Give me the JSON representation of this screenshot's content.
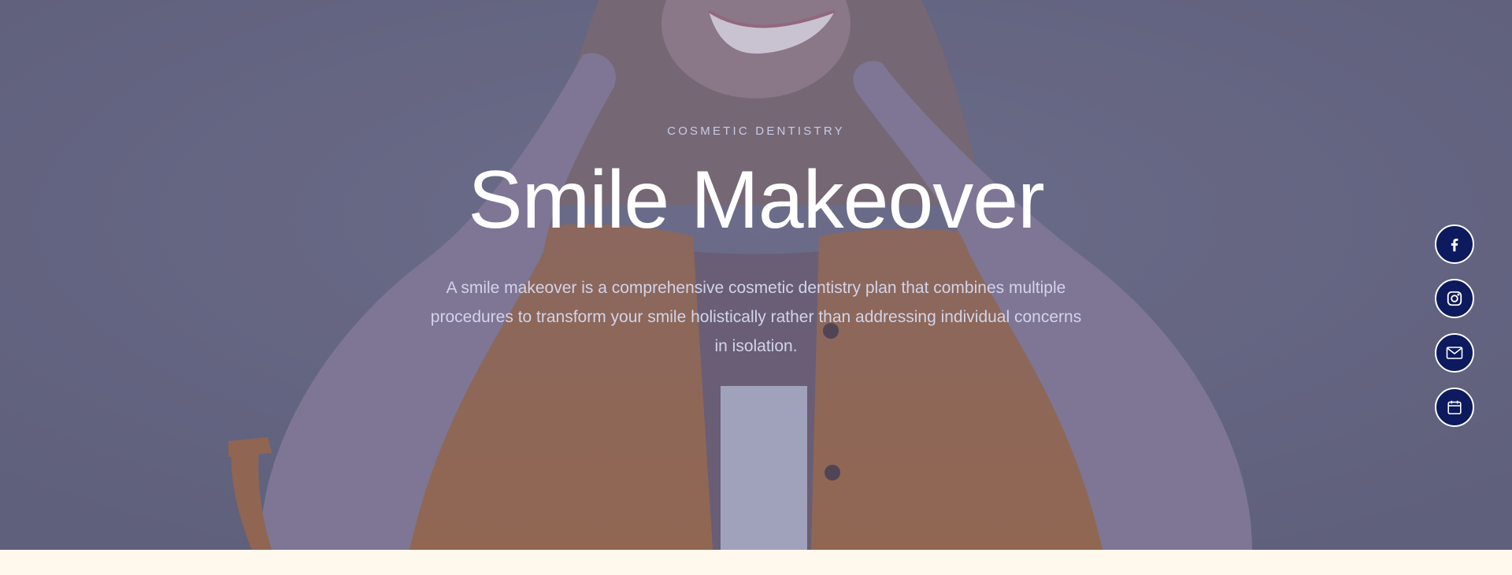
{
  "hero": {
    "eyebrow": "COSMETIC DENTISTRY",
    "title": "Smile Makeover",
    "description": "A smile makeover is a comprehensive cosmetic dentistry plan that combines multiple procedures to transform your smile holistically rather than addressing individual concerns in isolation."
  },
  "social": [
    {
      "icon": "facebook-icon"
    },
    {
      "icon": "instagram-icon"
    },
    {
      "icon": "mail-icon"
    },
    {
      "icon": "calendar-icon"
    }
  ],
  "colors": {
    "overlay": "#60628a",
    "social_button": "#0d1a5e",
    "footer_background": "#fff8ec",
    "shirt": "#b0703f"
  }
}
